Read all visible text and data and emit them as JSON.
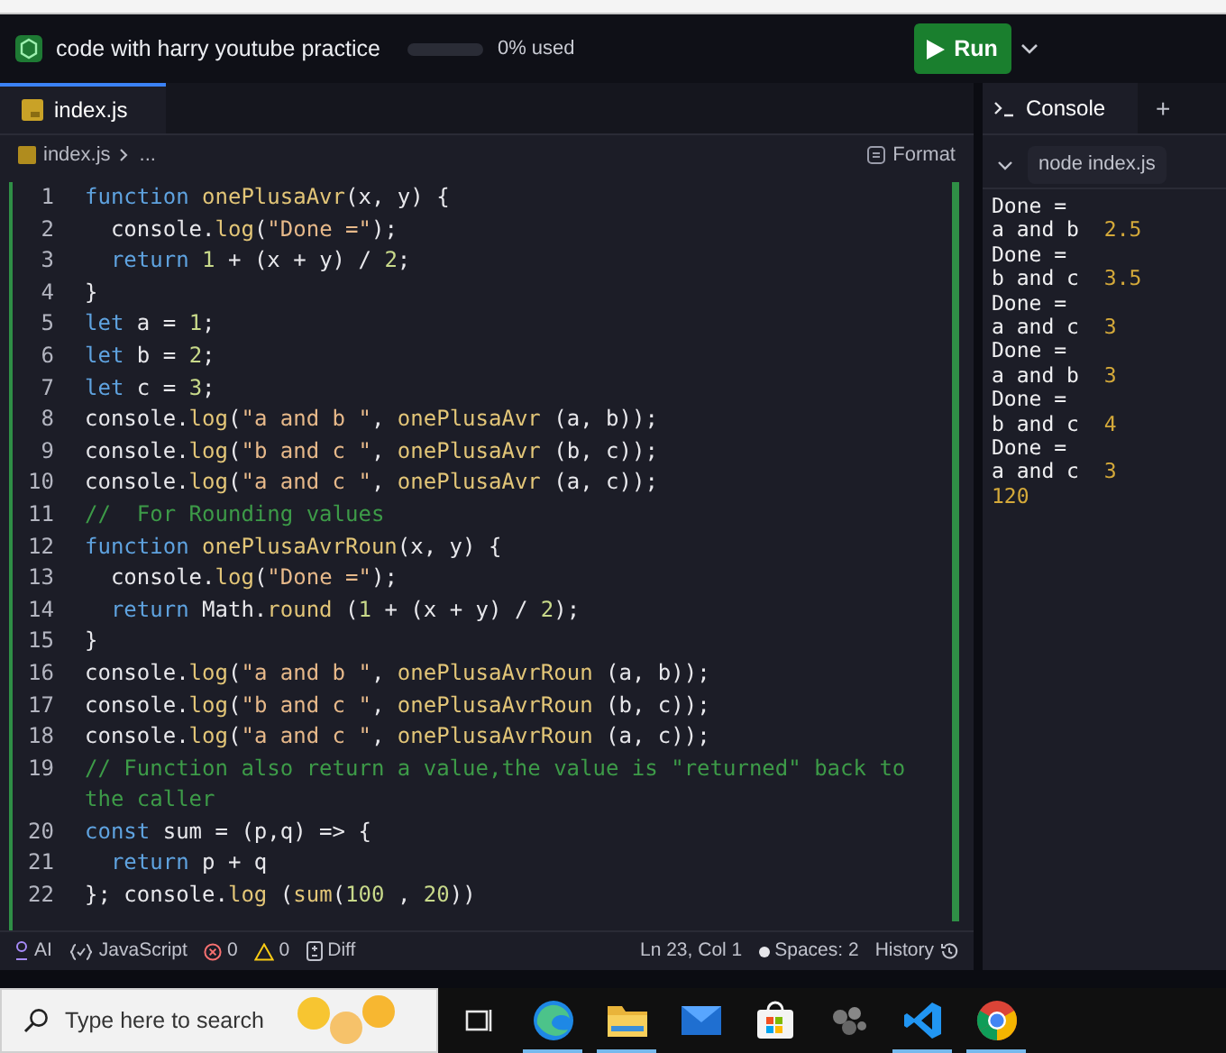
{
  "header": {
    "project_title": "code with harry youtube practice",
    "usage": {
      "level": 0,
      "label": "0% used"
    },
    "run_button": "Run"
  },
  "editor": {
    "tabs": [
      {
        "label": "index.js",
        "selected": true
      }
    ],
    "breadcrumb": {
      "file": "index.js",
      "rest": "..."
    },
    "format_button": "Format",
    "lines": [
      {
        "number": "1",
        "tokens": [
          {
            "kind": "keyword",
            "text": "function "
          },
          {
            "kind": "func",
            "text": "onePlusaAvr"
          },
          {
            "kind": "plain",
            "text": "(x, y) {"
          }
        ]
      },
      {
        "number": "2",
        "tokens": [
          {
            "kind": "plain",
            "text": "  console."
          },
          {
            "kind": "func",
            "text": "log"
          },
          {
            "kind": "plain",
            "text": "("
          },
          {
            "kind": "string",
            "text": "\"Done =\""
          },
          {
            "kind": "plain",
            "text": ");"
          }
        ]
      },
      {
        "number": "3",
        "tokens": [
          {
            "kind": "keyword",
            "text": "  return "
          },
          {
            "kind": "number",
            "text": "1"
          },
          {
            "kind": "plain",
            "text": " + (x + y) / "
          },
          {
            "kind": "number",
            "text": "2"
          },
          {
            "kind": "plain",
            "text": ";"
          }
        ]
      },
      {
        "number": "4",
        "tokens": [
          {
            "kind": "plain",
            "text": "}"
          }
        ]
      },
      {
        "number": "5",
        "tokens": [
          {
            "kind": "keyword",
            "text": "let "
          },
          {
            "kind": "plain",
            "text": "a = "
          },
          {
            "kind": "number",
            "text": "1"
          },
          {
            "kind": "plain",
            "text": ";"
          }
        ]
      },
      {
        "number": "6",
        "tokens": [
          {
            "kind": "keyword",
            "text": "let "
          },
          {
            "kind": "plain",
            "text": "b = "
          },
          {
            "kind": "number",
            "text": "2"
          },
          {
            "kind": "plain",
            "text": ";"
          }
        ]
      },
      {
        "number": "7",
        "tokens": [
          {
            "kind": "keyword",
            "text": "let "
          },
          {
            "kind": "plain",
            "text": "c = "
          },
          {
            "kind": "number",
            "text": "3"
          },
          {
            "kind": "plain",
            "text": ";"
          }
        ]
      },
      {
        "number": "8",
        "tokens": [
          {
            "kind": "plain",
            "text": "console."
          },
          {
            "kind": "func",
            "text": "log"
          },
          {
            "kind": "plain",
            "text": "("
          },
          {
            "kind": "string",
            "text": "\"a and b \""
          },
          {
            "kind": "plain",
            "text": ", "
          },
          {
            "kind": "func",
            "text": "onePlusaAvr"
          },
          {
            "kind": "plain",
            "text": " (a, b));"
          }
        ]
      },
      {
        "number": "9",
        "tokens": [
          {
            "kind": "plain",
            "text": "console."
          },
          {
            "kind": "func",
            "text": "log"
          },
          {
            "kind": "plain",
            "text": "("
          },
          {
            "kind": "string",
            "text": "\"b and c \""
          },
          {
            "kind": "plain",
            "text": ", "
          },
          {
            "kind": "func",
            "text": "onePlusaAvr"
          },
          {
            "kind": "plain",
            "text": " (b, c));"
          }
        ]
      },
      {
        "number": "10",
        "tokens": [
          {
            "kind": "plain",
            "text": "console."
          },
          {
            "kind": "func",
            "text": "log"
          },
          {
            "kind": "plain",
            "text": "("
          },
          {
            "kind": "string",
            "text": "\"a and c \""
          },
          {
            "kind": "plain",
            "text": ", "
          },
          {
            "kind": "func",
            "text": "onePlusaAvr"
          },
          {
            "kind": "plain",
            "text": " (a, c));"
          }
        ]
      },
      {
        "number": "11",
        "tokens": [
          {
            "kind": "comment",
            "text": "//  For Rounding values"
          }
        ]
      },
      {
        "number": "12",
        "tokens": [
          {
            "kind": "keyword",
            "text": "function "
          },
          {
            "kind": "func",
            "text": "onePlusaAvrRoun"
          },
          {
            "kind": "plain",
            "text": "(x, y) {"
          }
        ]
      },
      {
        "number": "13",
        "tokens": [
          {
            "kind": "plain",
            "text": "  console."
          },
          {
            "kind": "func",
            "text": "log"
          },
          {
            "kind": "plain",
            "text": "("
          },
          {
            "kind": "string",
            "text": "\"Done =\""
          },
          {
            "kind": "plain",
            "text": ");"
          }
        ]
      },
      {
        "number": "14",
        "tokens": [
          {
            "kind": "keyword",
            "text": "  return "
          },
          {
            "kind": "plain",
            "text": "Math."
          },
          {
            "kind": "func",
            "text": "round"
          },
          {
            "kind": "plain",
            "text": " ("
          },
          {
            "kind": "number",
            "text": "1"
          },
          {
            "kind": "plain",
            "text": " + (x + y) / "
          },
          {
            "kind": "number",
            "text": "2"
          },
          {
            "kind": "plain",
            "text": ");"
          }
        ]
      },
      {
        "number": "15",
        "tokens": [
          {
            "kind": "plain",
            "text": "}"
          }
        ]
      },
      {
        "number": "16",
        "tokens": [
          {
            "kind": "plain",
            "text": "console."
          },
          {
            "kind": "func",
            "text": "log"
          },
          {
            "kind": "plain",
            "text": "("
          },
          {
            "kind": "string",
            "text": "\"a and b \""
          },
          {
            "kind": "plain",
            "text": ", "
          },
          {
            "kind": "func",
            "text": "onePlusaAvrRoun"
          },
          {
            "kind": "plain",
            "text": " (a, b));"
          }
        ]
      },
      {
        "number": "17",
        "tokens": [
          {
            "kind": "plain",
            "text": "console."
          },
          {
            "kind": "func",
            "text": "log"
          },
          {
            "kind": "plain",
            "text": "("
          },
          {
            "kind": "string",
            "text": "\"b and c \""
          },
          {
            "kind": "plain",
            "text": ", "
          },
          {
            "kind": "func",
            "text": "onePlusaAvrRoun"
          },
          {
            "kind": "plain",
            "text": " (b, c));"
          }
        ]
      },
      {
        "number": "18",
        "tokens": [
          {
            "kind": "plain",
            "text": "console."
          },
          {
            "kind": "func",
            "text": "log"
          },
          {
            "kind": "plain",
            "text": "("
          },
          {
            "kind": "string",
            "text": "\"a and c \""
          },
          {
            "kind": "plain",
            "text": ", "
          },
          {
            "kind": "func",
            "text": "onePlusaAvrRoun"
          },
          {
            "kind": "plain",
            "text": " (a, c));"
          }
        ]
      },
      {
        "number": "19",
        "tokens": [
          {
            "kind": "comment",
            "text": "// Function also return a value,the value is \"returned\" back to the caller"
          }
        ]
      },
      {
        "number": "20",
        "tokens": [
          {
            "kind": "keyword",
            "text": "const "
          },
          {
            "kind": "plain",
            "text": "sum = (p,q) => {"
          }
        ]
      },
      {
        "number": "21",
        "tokens": [
          {
            "kind": "keyword",
            "text": "  return "
          },
          {
            "kind": "plain",
            "text": "p + q"
          }
        ]
      },
      {
        "number": "22",
        "tokens": [
          {
            "kind": "plain",
            "text": "}; console."
          },
          {
            "kind": "func",
            "text": "log"
          },
          {
            "kind": "plain",
            "text": " ("
          },
          {
            "kind": "func",
            "text": "sum"
          },
          {
            "kind": "plain",
            "text": "("
          },
          {
            "kind": "number",
            "text": "100"
          },
          {
            "kind": "plain",
            "text": " , "
          },
          {
            "kind": "number",
            "text": "20"
          },
          {
            "kind": "plain",
            "text": "))"
          }
        ]
      }
    ]
  },
  "status_bar": [
    {
      "kind": "ai",
      "label": "AI"
    },
    {
      "kind": "language",
      "label": "JavaScript"
    },
    {
      "kind": "errors",
      "label": "0"
    },
    {
      "kind": "warnings",
      "label": "0"
    },
    {
      "kind": "diff",
      "label": "Diff"
    },
    {
      "kind": "spacer"
    },
    {
      "kind": "position",
      "label": "Ln 23, Col 1"
    },
    {
      "kind": "spaces",
      "label": "Spaces: 2"
    },
    {
      "kind": "history",
      "label": "History"
    }
  ],
  "console": {
    "tabs": [
      {
        "label": "Console",
        "selected": true
      }
    ],
    "add_button": "+",
    "command": "node index.js",
    "output": [
      {
        "text": "Done ="
      },
      {
        "text": "a and b ",
        "value": "2.5"
      },
      {
        "text": "Done ="
      },
      {
        "text": "b and c ",
        "value": "3.5"
      },
      {
        "text": "Done ="
      },
      {
        "text": "a and c ",
        "value": "3"
      },
      {
        "text": "Done ="
      },
      {
        "text": "a and b ",
        "value": "3"
      },
      {
        "text": "Done ="
      },
      {
        "text": "b and c ",
        "value": "4"
      },
      {
        "text": "Done ="
      },
      {
        "text": "a and c ",
        "value": "3"
      },
      {
        "value": "120"
      }
    ]
  },
  "taskbar": {
    "search_placeholder": "Type here to search",
    "apps": [
      {
        "kind": "task_view",
        "running": false
      },
      {
        "kind": "edge",
        "running": true
      },
      {
        "kind": "folder",
        "running": true
      },
      {
        "kind": "mail",
        "running": false
      },
      {
        "kind": "store",
        "running": false
      },
      {
        "kind": "dots",
        "running": false
      },
      {
        "kind": "vscode",
        "running": true
      },
      {
        "kind": "chrome",
        "running": true
      }
    ]
  }
}
